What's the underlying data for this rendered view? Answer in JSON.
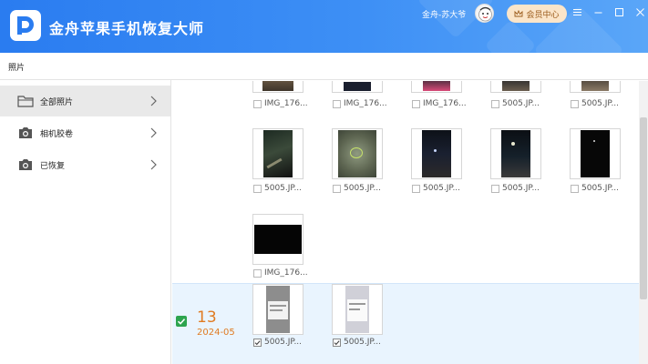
{
  "app": {
    "title": "金舟苹果手机恢复大师",
    "username": "金舟-苏大爷",
    "member_label": "会员中心"
  },
  "toolbar": {
    "breadcrumb": "照片"
  },
  "sidebar": {
    "items": [
      {
        "label": "全部照片",
        "icon": "folder-icon",
        "active": true
      },
      {
        "label": "相机胶卷",
        "icon": "camera-icon",
        "active": false
      },
      {
        "label": "已恢复",
        "icon": "camera-icon",
        "active": false
      }
    ]
  },
  "photos": {
    "row0": [
      "IMG_176...",
      "IMG_176...",
      "IMG_176...",
      "5005.JP...",
      "5005.JP..."
    ],
    "row1": [
      "5005.JP...",
      "5005.JP...",
      "5005.JP...",
      "5005.JP...",
      "5005.JP..."
    ],
    "row2": [
      "IMG_176..."
    ],
    "group": {
      "day": "13",
      "month": "2024-05",
      "items": [
        "5005.JP...",
        "5005.JP..."
      ]
    }
  },
  "colors": {
    "accent": "#2a7cf0",
    "date_orange": "#e07b22",
    "checked_green": "#2da44e",
    "member_bg": "#fbe5c9"
  }
}
